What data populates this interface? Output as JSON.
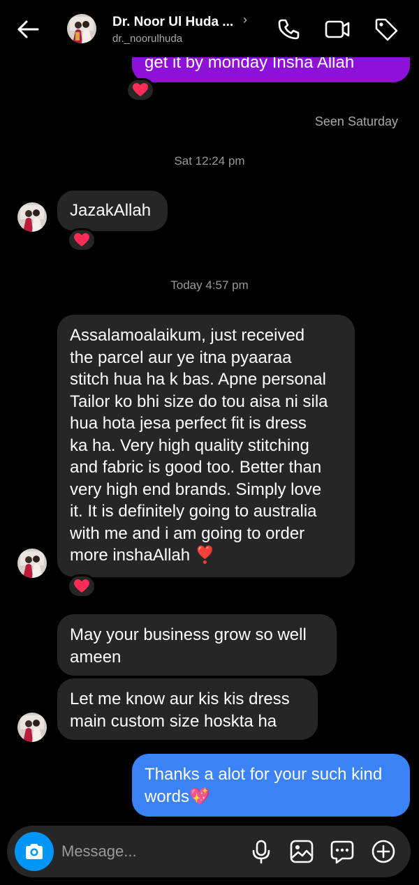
{
  "header": {
    "name": "Dr. Noor Ul Huda ...",
    "username": "dr._noorulhuda",
    "chevron": "›"
  },
  "messages": {
    "partial_out": "get it by monday Insha Allah",
    "seen": "Seen Saturday",
    "time1": "Sat 12:24 pm",
    "jazak": "JazakAllah",
    "time2": "Today 4:57 pm",
    "long_lines": [
      "Assalamoalaikum, just received",
      "the parcel aur ye itna pyaaraa",
      "stitch hua ha k bas. Apne personal",
      "Tailor ko bhi size do tou aisa ni sila",
      "hua hota jesa perfect fit is dress",
      "ka ha. Very high quality stitching",
      "and fabric is good too. Better than",
      "very high end brands. Simply love",
      "it. It is definitely going to australia",
      "with me and i am going to order",
      "more inshaAllah ❣️"
    ],
    "grow_lines": [
      "May your business grow so well",
      "ameen"
    ],
    "know_lines": [
      "Let me know aur kis kis dress",
      "main custom size hoskta ha"
    ],
    "thanks_lines": [
      "Thanks a alot for your such kind",
      "words💖"
    ]
  },
  "composer": {
    "placeholder": "Message..."
  },
  "icons": {
    "back": "arrow-left-icon",
    "call": "phone-icon",
    "video": "video-camera-icon",
    "tag": "tag-icon",
    "camera": "camera-icon",
    "mic": "microphone-icon",
    "gallery": "image-icon",
    "sticker": "chat-bubble-icon",
    "add": "plus-circle-icon",
    "reaction": "heart-icon"
  },
  "colors": {
    "background": "#000000",
    "incoming": "#262626",
    "outgoing_purple": "#8d11d8",
    "outgoing_blue": "#3b82f6",
    "camera_button": "#0095f6",
    "heart": "#ff2d55"
  }
}
